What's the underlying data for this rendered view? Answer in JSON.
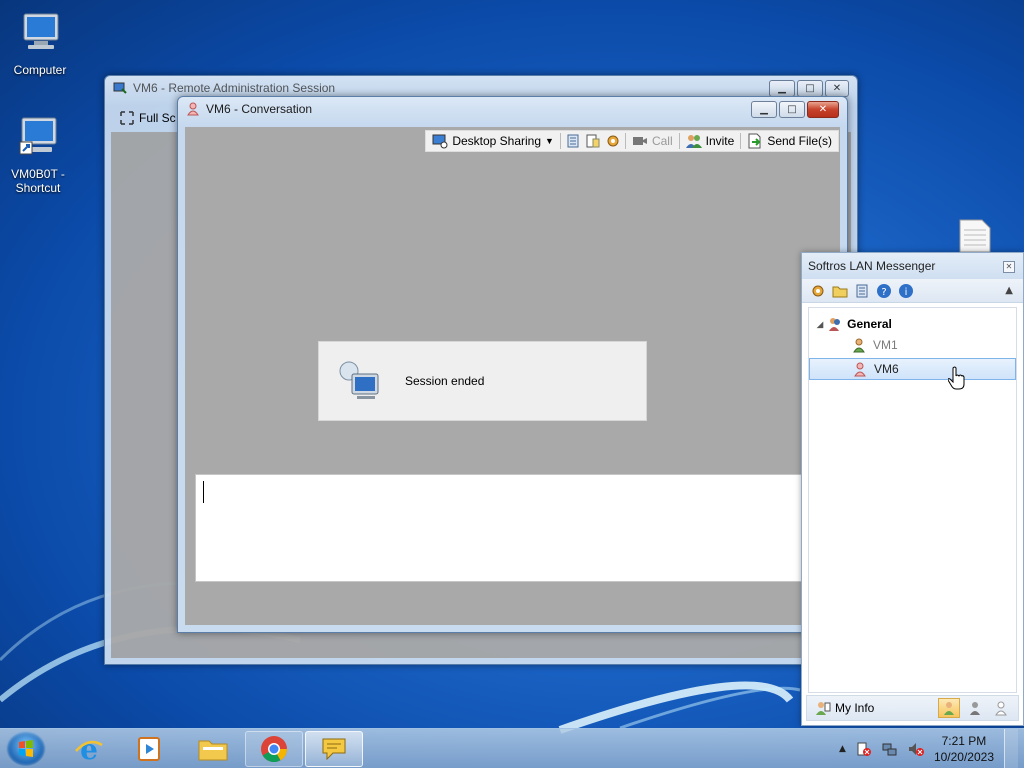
{
  "desktop": {
    "icons": [
      {
        "label": "Computer",
        "icon": "computer-icon"
      },
      {
        "label": "VM0B0T -\nShortcut",
        "icon": "computer-shortcut-icon"
      },
      {
        "label": "",
        "icon": "document-icon"
      }
    ]
  },
  "remote_window": {
    "title": "VM6 - Remote Administration Session",
    "toolbar": {
      "full_screen": "Full Sc"
    }
  },
  "conversation": {
    "title": "VM6 - Conversation",
    "toolbar": {
      "desktop_sharing": "Desktop Sharing",
      "call": "Call",
      "invite": "Invite",
      "send_files": "Send File(s)"
    },
    "session_message": "Session ended",
    "message_input": ""
  },
  "messenger": {
    "title": "Softros LAN Messenger",
    "group": "General",
    "contacts": [
      {
        "name": "VM1",
        "selected": false
      },
      {
        "name": "VM6",
        "selected": true
      }
    ],
    "footer": {
      "my_info": "My Info"
    }
  },
  "taskbar": {
    "apps": [
      "internet-explorer-icon",
      "media-player-icon",
      "file-explorer-icon",
      "chrome-icon",
      "lan-messenger-icon"
    ],
    "clock": {
      "time": "7:21 PM",
      "date": "10/20/2023"
    }
  },
  "colors": {
    "desktop_blue": "#1c66c8",
    "window_frame": "#c9dbef",
    "client_gray": "#a9a9a9",
    "close_red": "#c7422a",
    "selection": "#cfe3fa"
  }
}
